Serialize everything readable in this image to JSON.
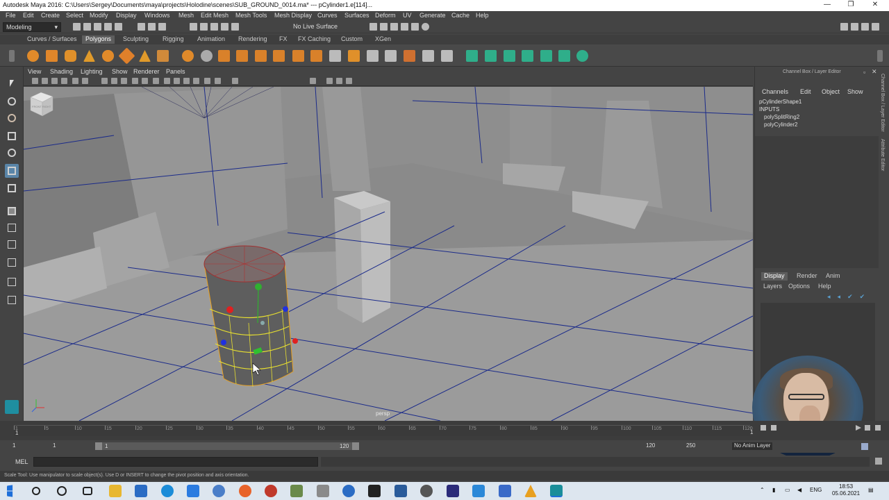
{
  "window": {
    "title": "Autodesk Maya 2016: C:\\Users\\Sergey\\Documents\\maya\\projects\\Holodine\\scenes\\SUB_GROUND_0014.ma*   ---   pCylinder1.e[114]...",
    "minimize": "—",
    "maximize": "❐",
    "close": "✕"
  },
  "menus": [
    "File",
    "Edit",
    "Create",
    "Select",
    "Modify",
    "Display",
    "Windows",
    "Mesh",
    "Edit Mesh",
    "Mesh Tools",
    "Mesh Display",
    "Curves",
    "Surfaces",
    "Deform",
    "UV",
    "Generate",
    "Cache",
    "Help"
  ],
  "status_line": {
    "mode": "Modeling",
    "live_surface": "No Live Surface"
  },
  "shelf_tabs": {
    "items": [
      "Curves / Surfaces",
      "Polygons",
      "Sculpting",
      "Rigging",
      "Animation",
      "Rendering",
      "FX",
      "FX Caching",
      "Custom",
      "XGen"
    ],
    "active": "Polygons"
  },
  "viewport": {
    "menus": [
      "View",
      "Shading",
      "Lighting",
      "Show",
      "Renderer",
      "Panels"
    ],
    "camera_label": "persp",
    "viewcube_label": "FRONT RIGHT"
  },
  "channel_box": {
    "header": "Channel Box / Layer Editor",
    "menus": [
      "Channels",
      "Edit",
      "Object",
      "Show"
    ],
    "shape": "pCylinderShape1",
    "inputs_label": "INPUTS",
    "inputs": [
      "polySplitRing2",
      "polyCylinder2"
    ],
    "side_tabs": [
      "Channel Box / Layer Editor",
      "Attribute Editor"
    ]
  },
  "layer_editor": {
    "tabs": [
      "Display",
      "Render",
      "Anim"
    ],
    "active_tab": "Display",
    "menus": [
      "Layers",
      "Options",
      "Help"
    ]
  },
  "time_slider": {
    "current_frame": "1",
    "tick_labels": [
      "1",
      "5",
      "10",
      "15",
      "20",
      "25",
      "30",
      "35",
      "40",
      "45",
      "50",
      "55",
      "60",
      "65",
      "70",
      "75",
      "80",
      "85",
      "90",
      "95",
      "100",
      "105",
      "110",
      "115",
      "120"
    ],
    "end_label": "1"
  },
  "range_slider": {
    "start": "1",
    "playback_start": "1",
    "bar_start": "1",
    "bar_end": "120",
    "playback_end": "120",
    "end": "250",
    "anim_layer": "No Anim Layer"
  },
  "command_line": {
    "language": "MEL"
  },
  "help_line": "Scale Tool: Use manipulator to scale object(s). Use D or INSERT to change the pivot position and axis orientation.",
  "taskbar": {
    "language": "ENG",
    "time": "18:53",
    "date": "05.06.2021"
  },
  "colors": {
    "maya_bg": "#444444",
    "viewport_bg": "#8a8a8a",
    "active_tab": "#5d5d5d",
    "selection_yellow": "#e8e030",
    "wire_blue": "#1a2a8a",
    "taskbar_bg": "#dde6ef"
  }
}
